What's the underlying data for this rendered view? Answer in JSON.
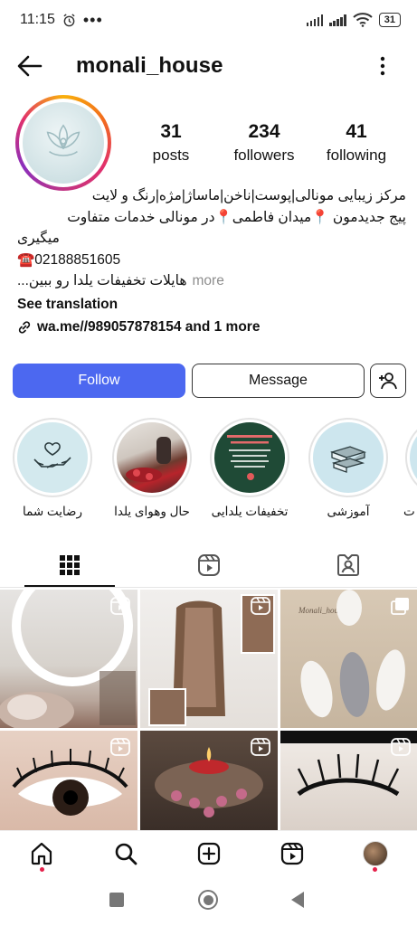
{
  "status": {
    "time": "11:15",
    "battery": "31"
  },
  "header": {
    "username": "monali_house"
  },
  "stats": {
    "posts_count": "31",
    "posts_label": "posts",
    "followers_count": "234",
    "followers_label": "followers",
    "following_count": "41",
    "following_label": "following"
  },
  "bio": {
    "line1": "مرکز زیبایی مونالی|پوست|ناخن|ماساژ|مژه|رنگ و لایت",
    "line2": "پیج جدیدمون 📍میدان فاطمی📍در مونالی خدمات متفاوت",
    "line3": "میگیری",
    "phone": "☎️02188851605",
    "line5": "هایلات تخفیفات یلدا رو ببین...",
    "more": "more",
    "see_translation": "See translation",
    "link": "wa.me//989057878154 and 1 more"
  },
  "actions": {
    "follow": "Follow",
    "message": "Message"
  },
  "highlights": [
    {
      "label": "رضایت شما",
      "icon": "hands-heart-icon"
    },
    {
      "label": "حال وهوای یلدا",
      "icon": "photo"
    },
    {
      "label": "تخفیفات یلدایی",
      "icon": "photo"
    },
    {
      "label": "آموزشی",
      "icon": "books-icon"
    },
    {
      "label": "ت",
      "icon": "partial"
    }
  ],
  "tabs": [
    "grid-icon",
    "reels-icon",
    "tagged-icon"
  ],
  "grid": {
    "post2_caption": "Monali_house"
  },
  "colors": {
    "follow_button": "#4c68f0",
    "accent_dot": "#e5204a",
    "text": "#111111",
    "muted": "#8e8e8e"
  }
}
